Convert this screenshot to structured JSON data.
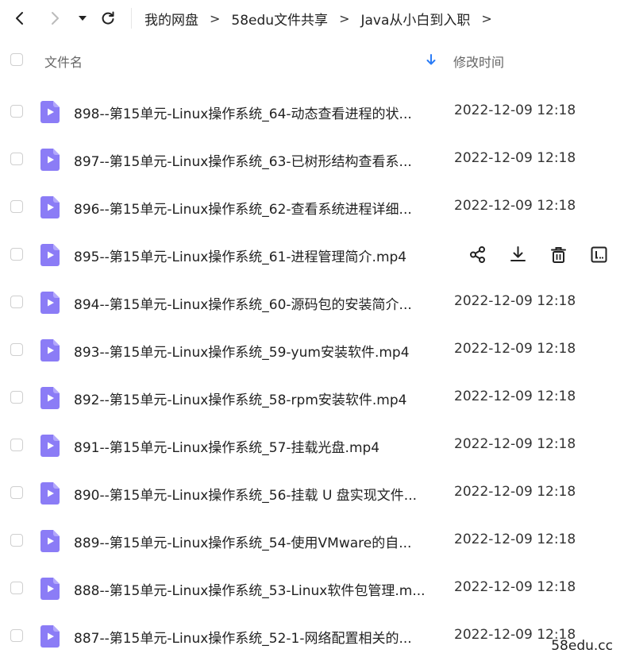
{
  "breadcrumb": {
    "items": [
      "我的网盘",
      "58edu文件共享",
      "Java从小白到入职"
    ],
    "separator": ">"
  },
  "table": {
    "header": {
      "name_label": "文件名",
      "time_label": "修改时间",
      "sort_icon": "arrow-down-icon"
    },
    "rows": [
      {
        "name": "898--第15单元-Linux操作系统_64-动态查看进程的状...",
        "date": "2022-12-09 12:18"
      },
      {
        "name": "897--第15单元-Linux操作系统_63-已树形结构查看系...",
        "date": "2022-12-09 12:18"
      },
      {
        "name": "896--第15单元-Linux操作系统_62-查看系统进程详细...",
        "date": "2022-12-09 12:18"
      },
      {
        "name": "895--第15单元-Linux操作系统_61-进程管理简介.mp4",
        "date": "",
        "hovered": true
      },
      {
        "name": "894--第15单元-Linux操作系统_60-源码包的安装简介...",
        "date": "2022-12-09 12:18"
      },
      {
        "name": "893--第15单元-Linux操作系统_59-yum安装软件.mp4",
        "date": "2022-12-09 12:18"
      },
      {
        "name": "892--第15单元-Linux操作系统_58-rpm安装软件.mp4",
        "date": "2022-12-09 12:18"
      },
      {
        "name": "891--第15单元-Linux操作系统_57-挂载光盘.mp4",
        "date": "2022-12-09 12:18"
      },
      {
        "name": "890--第15单元-Linux操作系统_56-挂载 U 盘实现文件...",
        "date": "2022-12-09 12:18"
      },
      {
        "name": "889--第15单元-Linux操作系统_54-使用VMware的自...",
        "date": "2022-12-09 12:18"
      },
      {
        "name": "888--第15单元-Linux操作系统_53-Linux软件包管理.m...",
        "date": "2022-12-09 12:18"
      },
      {
        "name": "887--第15单元-Linux操作系统_52-1-网络配置相关的...",
        "date": "2022-12-09 12:18"
      }
    ],
    "row_actions": [
      "share-icon",
      "download-icon",
      "delete-icon",
      "more-icon"
    ]
  },
  "watermark": "58edu.cc",
  "colors": {
    "video_icon": "#8b7cf6",
    "sort_icon": "#2b7cf6",
    "checkbox_border": "#cfcfcf"
  }
}
